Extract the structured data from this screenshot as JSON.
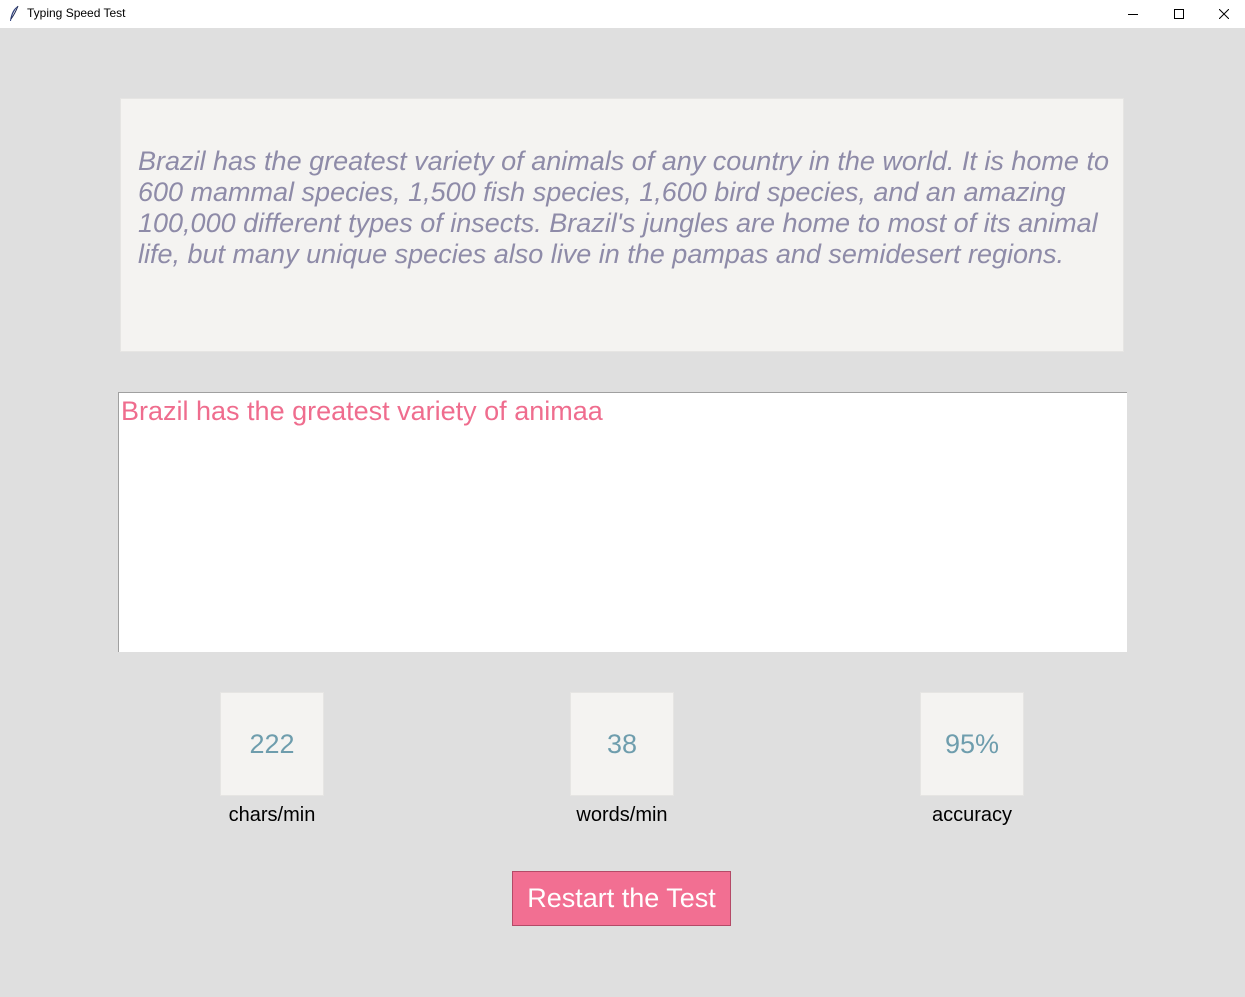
{
  "window": {
    "title": "Typing Speed Test",
    "controls": [
      "minimize-icon",
      "maximize-icon",
      "close-icon"
    ],
    "app_icon": "feather-icon"
  },
  "sample": {
    "text": "Brazil has the greatest variety of animals of any country in the world. It is home to 600 mammal species, 1,500 fish species, 1,600 bird species, and an amazing 100,000 different types of insects. Brazil's jungles are home to most of its animal life, but many unique species also live in the pampas and semidesert regions."
  },
  "input": {
    "typed_text": "Brazil has the greatest variety of animaa"
  },
  "stats": {
    "chars_per_min": {
      "value": "222",
      "label": "chars/min"
    },
    "words_per_min": {
      "value": "38",
      "label": "words/min"
    },
    "accuracy": {
      "value": "95%",
      "label": "accuracy"
    }
  },
  "actions": {
    "restart_label": "Restart the Test"
  },
  "colors": {
    "background": "#dfdfdf",
    "panel": "#f4f3f1",
    "sample_text": "#8e8ba8",
    "typed_text": "#ef6d8e",
    "stat_value": "#6e9dad",
    "button": "#f26f92"
  }
}
